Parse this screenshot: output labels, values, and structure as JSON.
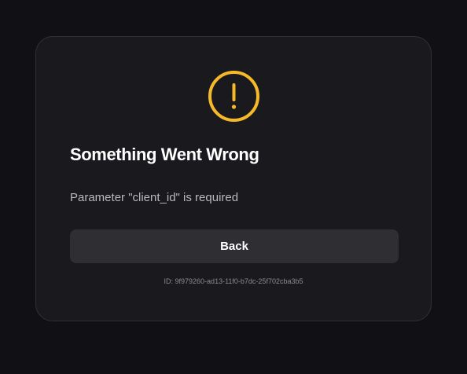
{
  "dialog": {
    "icon": "exclamation-circle-icon",
    "accent_color": "#f6b928",
    "title": "Something Went Wrong",
    "message": "Parameter \"client_id\" is required",
    "back_label": "Back",
    "error_id_text": "ID: 9f979260-ad13-11f0-b7dc-25f702cba3b5"
  }
}
